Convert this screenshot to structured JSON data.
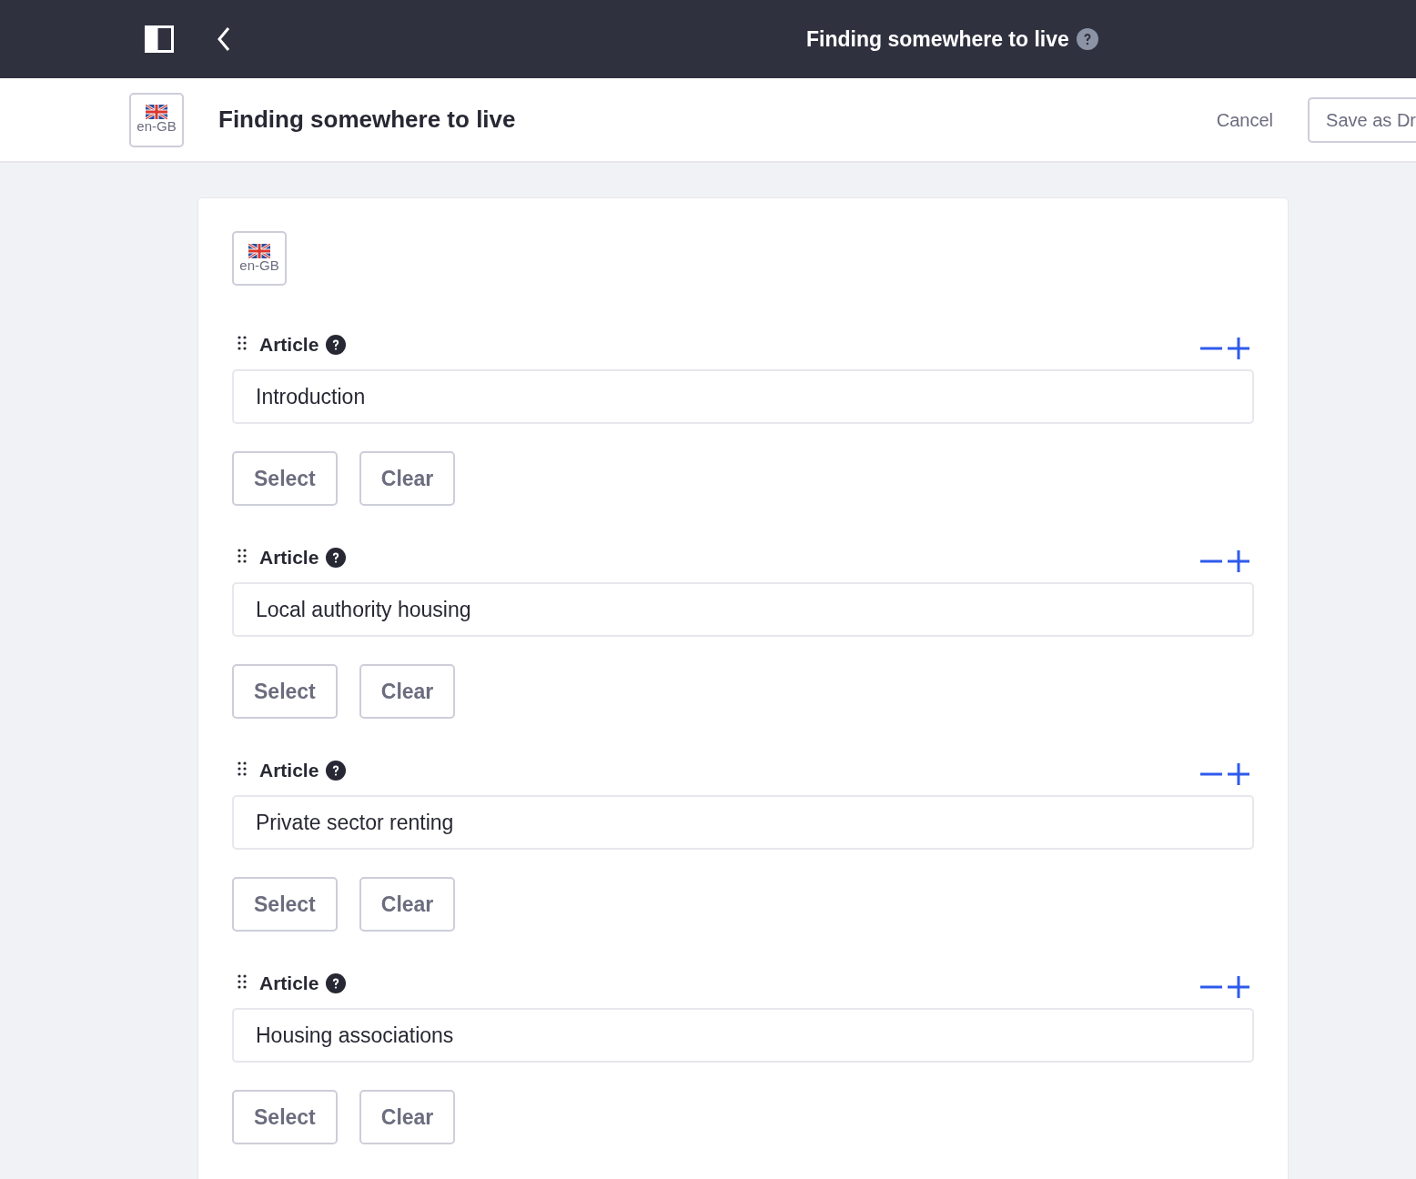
{
  "topbar": {
    "title": "Finding somewhere to live"
  },
  "header": {
    "locale": "en-GB",
    "title": "Finding somewhere to live",
    "cancel": "Cancel",
    "save": "Save as Dr"
  },
  "form": {
    "locale": "en-GB",
    "fields": [
      {
        "label": "Article",
        "value": "Introduction",
        "select": "Select",
        "clear": "Clear"
      },
      {
        "label": "Article",
        "value": "Local authority housing",
        "select": "Select",
        "clear": "Clear"
      },
      {
        "label": "Article",
        "value": "Private sector renting",
        "select": "Select",
        "clear": "Clear"
      },
      {
        "label": "Article",
        "value": "Housing associations",
        "select": "Select",
        "clear": "Clear"
      }
    ]
  }
}
